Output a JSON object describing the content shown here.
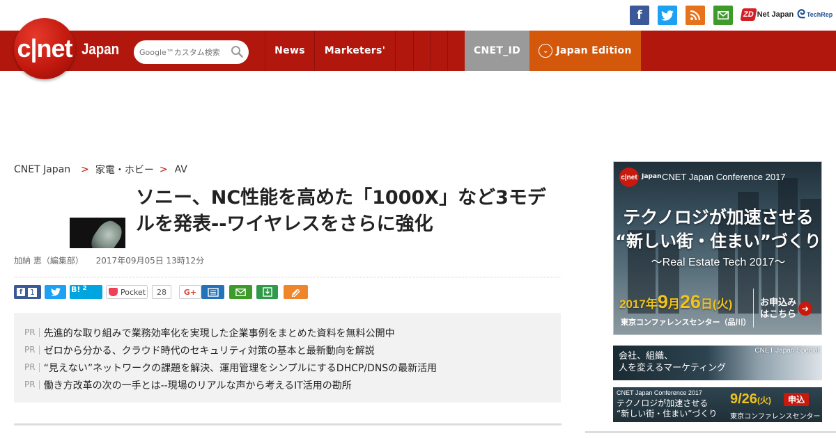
{
  "header": {
    "logo_text": "c|net",
    "logo_edition": "Japan",
    "search_placeholder": "Google™カスタム検索",
    "nav": [
      {
        "label": "News"
      },
      {
        "label": "Marketers'"
      },
      {
        "label": ""
      },
      {
        "label": ""
      },
      {
        "label": ""
      }
    ],
    "cnet_id": "CNET_ID",
    "edition": "Japan Edition",
    "zdnet_mark": "ZD",
    "zdnet_text": "Net Japan",
    "techrepublic_text": "TechRep"
  },
  "social_icons": [
    {
      "name": "facebook-icon",
      "color": "#3b5998",
      "glyph": "f"
    },
    {
      "name": "twitter-icon",
      "color": "#1da1f2",
      "glyph": "🐦"
    },
    {
      "name": "rss-icon",
      "color": "#e8711c",
      "glyph": "◔"
    },
    {
      "name": "mail-icon",
      "color": "#3e9a2b",
      "glyph": "✉"
    }
  ],
  "breadcrumb": {
    "home": "CNET Japan",
    "sep": ">",
    "category": "家電・ホビー",
    "sub": "AV"
  },
  "article": {
    "headline": "ソニー、NC性能を高めた「1000X」など3モデルを発表--ワイヤレスをさらに強化",
    "author": "加納 恵（編集部）",
    "date": "2017年09月05日 13時12分"
  },
  "share": {
    "facebook_count": "1",
    "hatena_label": "B!",
    "hatena_count": "2",
    "pocket_label": "Pocket",
    "pocket_count": "28",
    "gplus_label": "G+"
  },
  "pr": {
    "label": "PR",
    "items": [
      "先進的な取り組みで業務効率化を実現した企業事例をまとめた資料を無料公開中",
      "ゼロから分かる、クラウド時代のセキュリティ対策の基本と最新動向を解説",
      "“見えない”ネットワークの課題を解決、運用管理をシンプルにするDHCP/DNSの最新活用",
      "働き方改革の次の一手とは--現場のリアルな声から考えるIT活用の勘所"
    ]
  },
  "ads": {
    "banner": {
      "logo": "c|net",
      "logo_japan": "Japan",
      "conf": "CNET Japan Conference 2017",
      "line1": "テクノロジが加速させる",
      "line2": "“新しい街・住まい”づくり",
      "line3": "〜Real Estate Tech 2017〜",
      "year": "2017",
      "nen": "年",
      "month": "9",
      "tsuki": "月",
      "day": "26",
      "nichi": "日",
      "weekday": "(火)",
      "venue": "東京コンファレンスセンター（品川）",
      "cta1": "お申込み",
      "cta2": "はこちら"
    },
    "ad2": {
      "line1": "会社、組織、",
      "line2": "人を変えるマーケティング",
      "special": "CNET Japan Special"
    },
    "ad3": {
      "conf": "CNET Japan Conference 2017",
      "line1": "テクノロジが加速させる",
      "line2": "“新しい街・住まい”づくり",
      "date": "9/26",
      "weekday": "(火)",
      "venue": "東京コンファレンスセンター",
      "button": "申込"
    }
  }
}
